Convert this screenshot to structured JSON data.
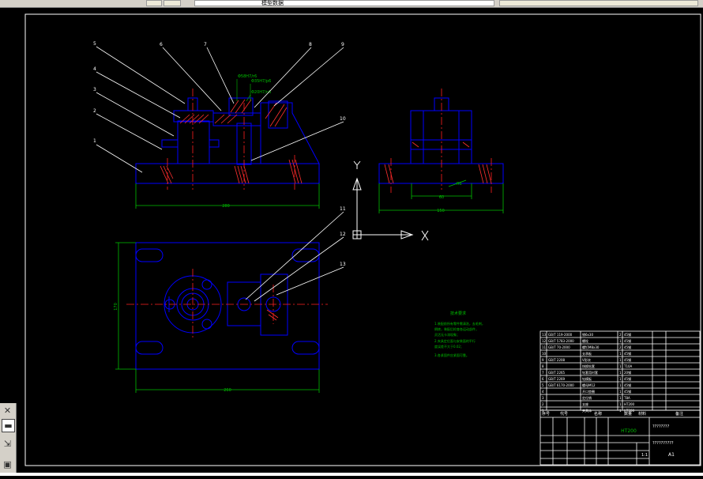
{
  "toolbar": {
    "icons": [
      "layer-icon",
      "grid-icon",
      "properties-icon"
    ],
    "field_text": "模型数据"
  },
  "drawing": {
    "balloons": [
      "1",
      "2",
      "3",
      "4",
      "5",
      "6",
      "7",
      "8",
      "9",
      "10",
      "11",
      "12",
      "13"
    ],
    "dims": {
      "front_width": "280",
      "side_width": "150",
      "side_inner": "60",
      "side_note": "R6",
      "top_width": "260",
      "top_height": "170",
      "fit_a": "Φ58H7/r6",
      "fit_b": "Φ35H7/p6",
      "fit_c": "Φ20H7/n6"
    },
    "ucs": {
      "x_label": "X",
      "y_label": "Y"
    },
    "notes": {
      "title": "技术要求",
      "lines": [
        "1.装配前所有零件需清洗，去毛刺，",
        "倒棱，装配后检查各运动部件，",
        "灵活无卡滞现象；",
        "2.夹具定位面与安装面的平行",
        "度误差不大于0.02；",
        "3.各紧固件应紧固可靠。"
      ]
    }
  },
  "title_block": {
    "rows": [
      {
        "no": "13",
        "code": "GB/T 119-2000",
        "name": "销6x30",
        "qty": "2",
        "mat": "45钢"
      },
      {
        "no": "12",
        "code": "GB/T 5783-2000",
        "name": "螺栓",
        "qty": "1",
        "mat": "45钢"
      },
      {
        "no": "11",
        "code": "GB/T 70-2000",
        "name": "螺钉M8x30",
        "qty": "2",
        "mat": "45钢"
      },
      {
        "no": "10",
        "code": "",
        "name": "支承板",
        "qty": "1",
        "mat": "45钢"
      },
      {
        "no": "9",
        "code": "GB/T 2208",
        "name": "V形块",
        "qty": "1",
        "mat": "45钢"
      },
      {
        "no": "8",
        "code": "",
        "name": "快换钻套",
        "qty": "1",
        "mat": "T10A"
      },
      {
        "no": "7",
        "code": "GB/T 2265",
        "name": "钻套用衬套",
        "qty": "1",
        "mat": "20钢"
      },
      {
        "no": "6",
        "code": "GB/T 2269",
        "name": "钻模板",
        "qty": "1",
        "mat": "45钢"
      },
      {
        "no": "5",
        "code": "GB/T 6170-2000",
        "name": "螺母M12",
        "qty": "1",
        "mat": "45钢"
      },
      {
        "no": "4",
        "code": "",
        "name": "开口垫圈",
        "qty": "1",
        "mat": "45钢"
      },
      {
        "no": "3",
        "code": "",
        "name": "定位销",
        "qty": "1",
        "mat": "T8A"
      },
      {
        "no": "2",
        "code": "",
        "name": "支座",
        "qty": "1",
        "mat": "HT200"
      },
      {
        "no": "1",
        "code": "",
        "name": "夹具体",
        "qty": "1",
        "mat": "HT200"
      }
    ],
    "header": [
      "序号",
      "代号",
      "名称",
      "数量",
      "材料",
      "备注"
    ],
    "material": "HT200",
    "drawing_name": "????????",
    "drawing_no": "??????????",
    "scale": "1:1",
    "sheet": "A1"
  },
  "left_panel": {
    "icons": [
      "close-icon",
      "panel-icon",
      "arrow-icon",
      "layout-icon"
    ]
  }
}
